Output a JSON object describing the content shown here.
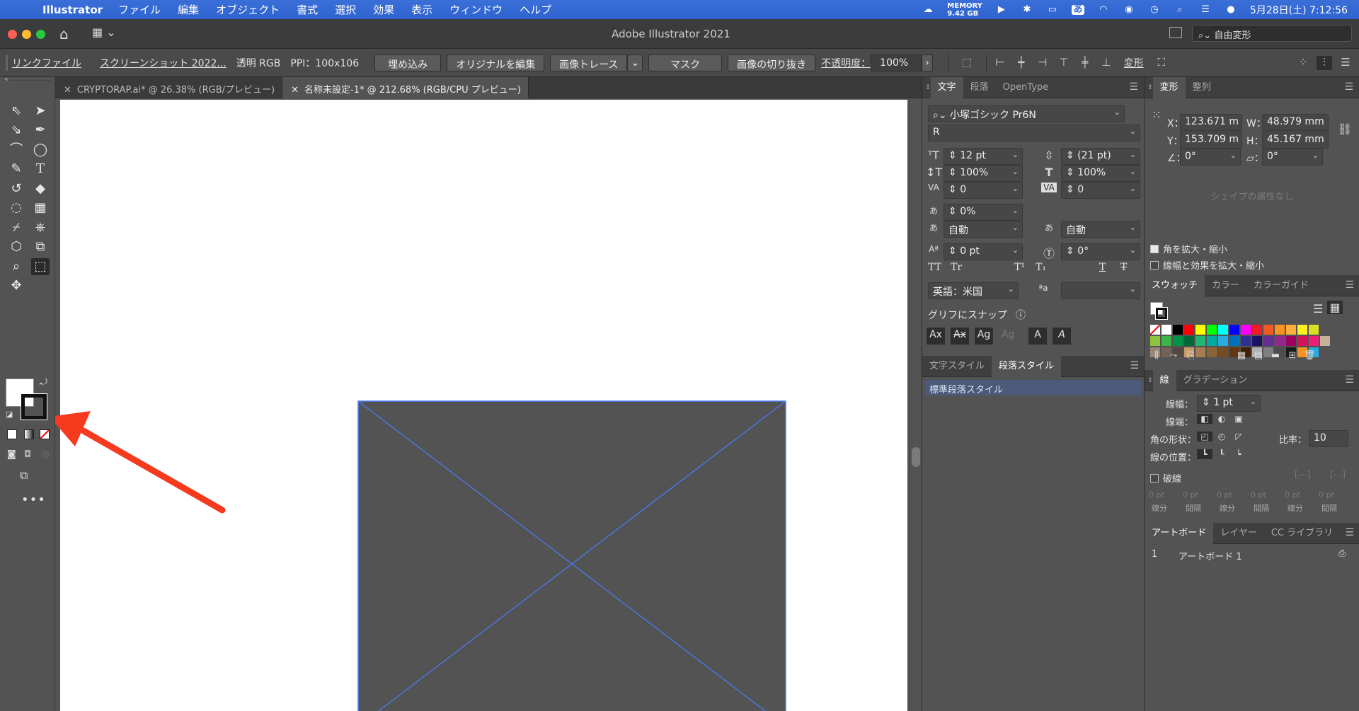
{
  "menubar": {
    "app": "Illustrator",
    "items": [
      "ファイル",
      "編集",
      "オブジェクト",
      "書式",
      "選択",
      "効果",
      "表示",
      "ウィンドウ",
      "ヘルプ"
    ],
    "memory_label": "MEMORY",
    "memory_value": "9.42 GB",
    "input_method": "あ",
    "datetime": "5月28日(土)  7:12:56"
  },
  "window": {
    "title": "Adobe Illustrator 2021",
    "search_text": "自由変形"
  },
  "controlbar": {
    "link_file": "リンクファイル",
    "filename": "スクリーンショット 2022...",
    "color_mode": "透明 RGB",
    "ppi": "PPI：100x106",
    "embed_btn": "埋め込み",
    "edit_original_btn": "オリジナルを編集",
    "image_trace_btn": "画像トレース",
    "mask_btn": "マスク",
    "crop_btn": "画像の切り抜き",
    "opacity_label": "不透明度：",
    "opacity_value": "100%",
    "transform_label": "変形"
  },
  "doc_tabs": [
    {
      "label": "CRYPTORAP.ai* @ 26.38% (RGB/プレビュー)"
    },
    {
      "label": "名称未設定-1* @ 212.68% (RGB/CPU プレビュー)"
    }
  ],
  "more_tools": "•••",
  "char_panel": {
    "tabs": [
      "文字",
      "段落",
      "OpenType"
    ],
    "font_family": "小塚ゴシック Pr6N",
    "font_style": "R",
    "size": "12 pt",
    "leading": "(21 pt)",
    "vscale": "100%",
    "hscale": "100%",
    "kerning": "0",
    "tracking": "0",
    "tsume": "0%",
    "aki_left": "自動",
    "aki_right": "自動",
    "baseline": "0 pt",
    "rotation": "0°",
    "language": "英語：米国",
    "snap_title": "グリフにスナップ"
  },
  "style_panel": {
    "tabs": [
      "文字スタイル",
      "段落スタイル"
    ],
    "item": "標準段落スタイル"
  },
  "transform_panel": {
    "tabs": [
      "変形",
      "整列"
    ],
    "x": "123.671 m",
    "y": "153.709 m",
    "w": "48.979 mm",
    "h": "45.167 mm",
    "angle": "0°",
    "shear": "0°",
    "no_shape": "シェイプの属性なし",
    "scale_corners": "角を拡大・縮小",
    "scale_strokes": "線幅と効果を拡大・縮小"
  },
  "swatch_panel": {
    "tabs": [
      "スウォッチ",
      "カラー",
      "カラーガイド"
    ],
    "row1": [
      "#ffffff",
      "#000000",
      "#ff0000",
      "#ffff00",
      "#00ff00",
      "#00ffff",
      "#0000ff",
      "#ff00ff",
      "#ed1c24",
      "#f15a24",
      "#f7931e",
      "#fbb03b",
      "#fcee21",
      "#d9e021"
    ],
    "row2": [
      "#8cc63f",
      "#39b54a",
      "#009245",
      "#006837",
      "#22b573",
      "#00a99d",
      "#29abe2",
      "#0071bc",
      "#2e3192",
      "#1b1464",
      "#662d91",
      "#93278f",
      "#9e005d",
      "#d4145a",
      "#ed1e79",
      "#c7b299"
    ],
    "row3": [
      "#998675",
      "#736357",
      "#534741",
      "#c69c6d",
      "#a67c52",
      "#8c6239",
      "#754c24",
      "#603813",
      "#42210b",
      "#b3b3b3",
      "#808080",
      "#4d4d4d",
      "#1a1a1a",
      "#f7931e",
      "#29abe2"
    ]
  },
  "stroke_panel": {
    "tabs": [
      "線",
      "グラデーション"
    ],
    "weight_label": "線幅：",
    "weight": "1 pt",
    "cap_label": "線端：",
    "corner_label": "角の形状：",
    "ratio_label": "比率：",
    "ratio": "10",
    "align_label": "線の位置：",
    "dash_label": "破線",
    "dash_values": [
      "0 pt",
      "0 pt",
      "0 pt",
      "0 pt",
      "0 pt",
      "0 pt"
    ],
    "dash_captions": [
      "線分",
      "間隔",
      "線分",
      "間隔",
      "線分",
      "間隔"
    ]
  },
  "artboard_panel": {
    "tabs": [
      "アートボード",
      "レイヤー",
      "CC ライブラリ"
    ],
    "row_index": "1",
    "row_name": "アートボード 1"
  }
}
